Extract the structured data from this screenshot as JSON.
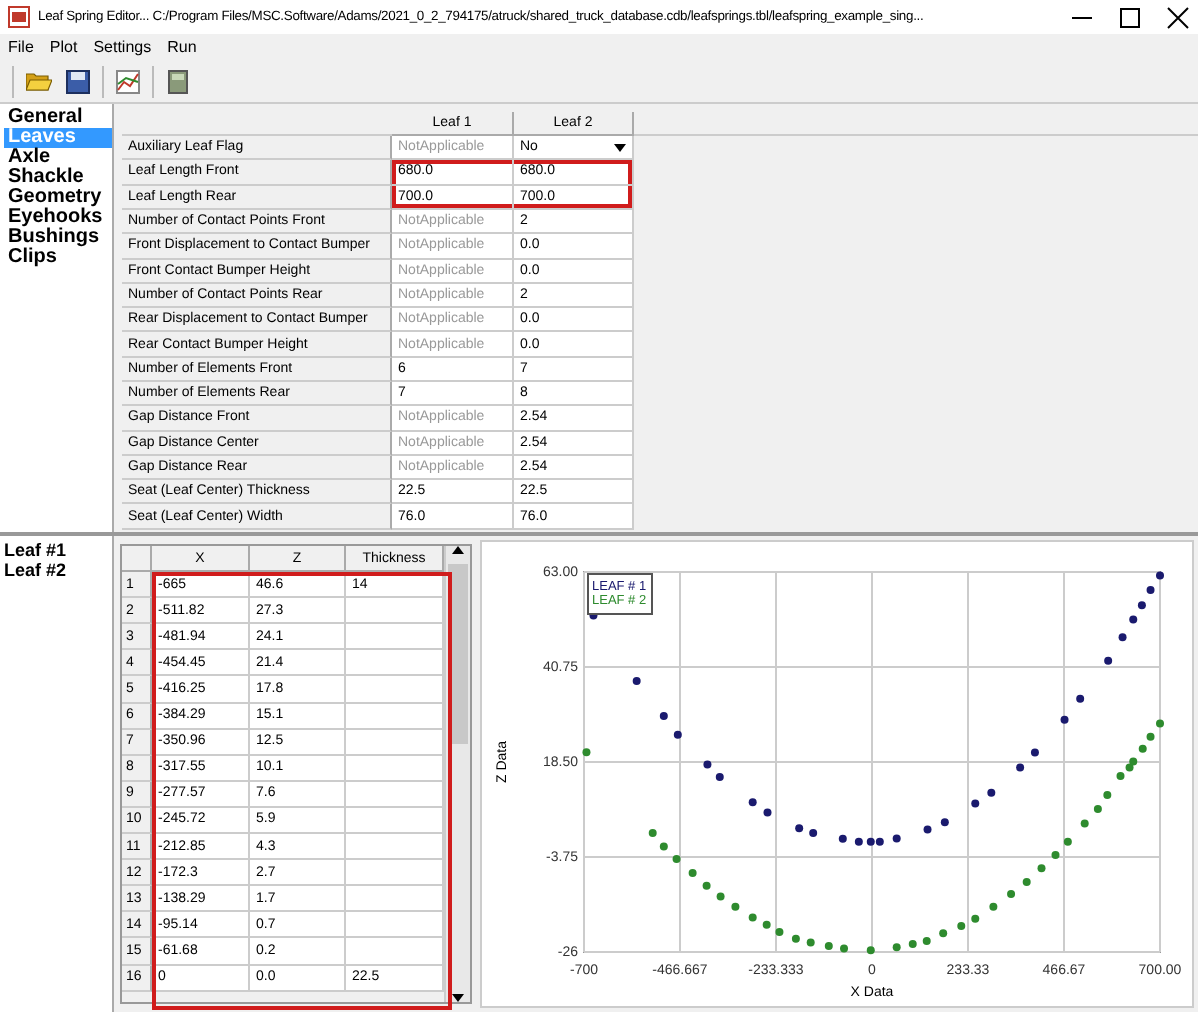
{
  "window": {
    "title": "Leaf Spring Editor... C:/Program Files/MSC.Software/Adams/2021_0_2_794175/atruck/shared_truck_database.cdb/leafsprings.tbl/leafspring_example_sing..."
  },
  "menu": [
    "File",
    "Plot",
    "Settings",
    "Run"
  ],
  "nav": [
    {
      "label": "General",
      "selected": false
    },
    {
      "label": "Leaves",
      "selected": true
    },
    {
      "label": "Axle",
      "selected": false
    },
    {
      "label": "Shackle",
      "selected": false
    },
    {
      "label": "Geometry",
      "selected": false
    },
    {
      "label": "Eyehooks",
      "selected": false
    },
    {
      "label": "Bushings",
      "selected": false
    },
    {
      "label": "Clips",
      "selected": false
    }
  ],
  "properties": {
    "columns": [
      "Leaf 1",
      "Leaf 2"
    ],
    "rows": [
      {
        "label": "Auxiliary Leaf Flag",
        "highlighted": false,
        "cells": [
          {
            "value": "NotApplicable",
            "disabled": true,
            "kind": "text"
          },
          {
            "value": "No",
            "disabled": false,
            "kind": "dropdown"
          }
        ]
      },
      {
        "label": "Leaf Length Front",
        "highlighted": true,
        "cells": [
          {
            "value": "680.0",
            "disabled": false,
            "kind": "text"
          },
          {
            "value": "680.0",
            "disabled": false,
            "kind": "text"
          }
        ]
      },
      {
        "label": "Leaf Length Rear",
        "highlighted": true,
        "cells": [
          {
            "value": "700.0",
            "disabled": false,
            "kind": "text"
          },
          {
            "value": "700.0",
            "disabled": false,
            "kind": "text"
          }
        ]
      },
      {
        "label": "Number of Contact Points Front",
        "highlighted": false,
        "cells": [
          {
            "value": "NotApplicable",
            "disabled": true,
            "kind": "text"
          },
          {
            "value": "2",
            "disabled": false,
            "kind": "text"
          }
        ]
      },
      {
        "label": "Front Displacement to Contact Bumper",
        "highlighted": false,
        "cells": [
          {
            "value": "NotApplicable",
            "disabled": true,
            "kind": "text"
          },
          {
            "value": "0.0",
            "disabled": false,
            "kind": "text"
          }
        ]
      },
      {
        "label": "Front Contact Bumper Height",
        "highlighted": false,
        "cells": [
          {
            "value": "NotApplicable",
            "disabled": true,
            "kind": "text"
          },
          {
            "value": "0.0",
            "disabled": false,
            "kind": "text"
          }
        ]
      },
      {
        "label": "Number of Contact Points Rear",
        "highlighted": false,
        "cells": [
          {
            "value": "NotApplicable",
            "disabled": true,
            "kind": "text"
          },
          {
            "value": "2",
            "disabled": false,
            "kind": "text"
          }
        ]
      },
      {
        "label": "Rear Displacement to Contact Bumper",
        "highlighted": false,
        "cells": [
          {
            "value": "NotApplicable",
            "disabled": true,
            "kind": "text"
          },
          {
            "value": "0.0",
            "disabled": false,
            "kind": "text"
          }
        ]
      },
      {
        "label": "Rear Contact Bumper Height",
        "highlighted": false,
        "cells": [
          {
            "value": "NotApplicable",
            "disabled": true,
            "kind": "text"
          },
          {
            "value": "0.0",
            "disabled": false,
            "kind": "text"
          }
        ]
      },
      {
        "label": "Number of Elements Front",
        "highlighted": false,
        "cells": [
          {
            "value": "6",
            "disabled": false,
            "kind": "text"
          },
          {
            "value": "7",
            "disabled": false,
            "kind": "text"
          }
        ]
      },
      {
        "label": "Number of Elements Rear",
        "highlighted": false,
        "cells": [
          {
            "value": "7",
            "disabled": false,
            "kind": "text"
          },
          {
            "value": "8",
            "disabled": false,
            "kind": "text"
          }
        ]
      },
      {
        "label": "Gap Distance Front",
        "highlighted": false,
        "cells": [
          {
            "value": "NotApplicable",
            "disabled": true,
            "kind": "text"
          },
          {
            "value": "2.54",
            "disabled": false,
            "kind": "text"
          }
        ]
      },
      {
        "label": "Gap Distance Center",
        "highlighted": false,
        "cells": [
          {
            "value": "NotApplicable",
            "disabled": true,
            "kind": "text"
          },
          {
            "value": "2.54",
            "disabled": false,
            "kind": "text"
          }
        ]
      },
      {
        "label": "Gap Distance Rear",
        "highlighted": false,
        "cells": [
          {
            "value": "NotApplicable",
            "disabled": true,
            "kind": "text"
          },
          {
            "value": "2.54",
            "disabled": false,
            "kind": "text"
          }
        ]
      },
      {
        "label": "Seat (Leaf Center) Thickness",
        "highlighted": false,
        "cells": [
          {
            "value": "22.5",
            "disabled": false,
            "kind": "text"
          },
          {
            "value": "22.5",
            "disabled": false,
            "kind": "text"
          }
        ]
      },
      {
        "label": "Seat (Leaf Center) Width",
        "highlighted": false,
        "cells": [
          {
            "value": "76.0",
            "disabled": false,
            "kind": "text"
          },
          {
            "value": "76.0",
            "disabled": false,
            "kind": "text"
          }
        ]
      }
    ]
  },
  "leaves": [
    {
      "label": "Leaf #1"
    },
    {
      "label": "Leaf #2"
    }
  ],
  "points": {
    "highlighted": true,
    "columns": [
      "X",
      "Z",
      "Thickness"
    ],
    "rows": [
      {
        "index": "1",
        "cells": [
          "-665",
          "46.6",
          "14"
        ]
      },
      {
        "index": "2",
        "cells": [
          "-511.82",
          "27.3",
          ""
        ]
      },
      {
        "index": "3",
        "cells": [
          "-481.94",
          "24.1",
          ""
        ]
      },
      {
        "index": "4",
        "cells": [
          "-454.45",
          "21.4",
          ""
        ]
      },
      {
        "index": "5",
        "cells": [
          "-416.25",
          "17.8",
          ""
        ]
      },
      {
        "index": "6",
        "cells": [
          "-384.29",
          "15.1",
          ""
        ]
      },
      {
        "index": "7",
        "cells": [
          "-350.96",
          "12.5",
          ""
        ]
      },
      {
        "index": "8",
        "cells": [
          "-317.55",
          "10.1",
          ""
        ]
      },
      {
        "index": "9",
        "cells": [
          "-277.57",
          "7.6",
          ""
        ]
      },
      {
        "index": "10",
        "cells": [
          "-245.72",
          "5.9",
          ""
        ]
      },
      {
        "index": "11",
        "cells": [
          "-212.85",
          "4.3",
          ""
        ]
      },
      {
        "index": "12",
        "cells": [
          "-172.3",
          "2.7",
          ""
        ]
      },
      {
        "index": "13",
        "cells": [
          "-138.29",
          "1.7",
          ""
        ]
      },
      {
        "index": "14",
        "cells": [
          "-95.14",
          "0.7",
          ""
        ]
      },
      {
        "index": "15",
        "cells": [
          "-61.68",
          "0.2",
          ""
        ]
      },
      {
        "index": "16",
        "cells": [
          "0",
          "0.0",
          "22.5"
        ]
      }
    ]
  },
  "plot": {
    "chart_data": {
      "type": "scatter",
      "grid": true,
      "xlabel": "X Data",
      "ylabel": "Z Data",
      "xlim": [
        -700,
        700
      ],
      "ylim": [
        -26,
        63
      ],
      "xticks": [
        {
          "value": -700,
          "label": "-700"
        },
        {
          "value": -466.667,
          "label": "-466.667"
        },
        {
          "value": -233.333,
          "label": "-233.333"
        },
        {
          "value": 0,
          "label": "0"
        },
        {
          "value": 233.33,
          "label": "233.33"
        },
        {
          "value": 466.67,
          "label": "466.67"
        },
        {
          "value": 700,
          "label": "700.00"
        }
      ],
      "yticks": [
        {
          "value": 63,
          "label": "63.00"
        },
        {
          "value": 40.75,
          "label": "40.75"
        },
        {
          "value": 18.5,
          "label": "18.50"
        },
        {
          "value": -3.75,
          "label": "-3.75"
        },
        {
          "value": -26,
          "label": "-26"
        }
      ],
      "series": [
        {
          "name": "LEAF # 1",
          "color": "#1a1a6e",
          "x": [
            -677,
            -572,
            -506,
            -472,
            -400,
            -370,
            -290,
            -254,
            -177,
            -143,
            -71,
            -32,
            -3,
            19,
            60,
            135,
            177,
            251,
            290,
            360,
            396,
            468,
            506,
            574,
            609,
            635,
            656,
            677,
            700
          ],
          "values": [
            52.8,
            37.5,
            29.3,
            24.9,
            17.9,
            15.0,
            9.1,
            6.7,
            3.0,
            1.9,
            0.5,
            -0.2,
            -0.2,
            -0.2,
            0.6,
            2.7,
            4.4,
            8.8,
            11.3,
            17.2,
            20.7,
            28.4,
            33.3,
            42.2,
            47.7,
            51.9,
            55.2,
            58.8,
            62.2
          ]
        },
        {
          "name": "LEAF # 2",
          "color": "#2e8b2e",
          "x": [
            -694,
            -533,
            -506,
            -475,
            -436,
            -402,
            -368,
            -332,
            -290,
            -256,
            -225,
            -185,
            -149,
            -105,
            -68,
            -3,
            60,
            99,
            133,
            173,
            217,
            251,
            295,
            338,
            376,
            412,
            446,
            476,
            517,
            549,
            572,
            604,
            626,
            635,
            658,
            677,
            700
          ],
          "values": [
            20.8,
            1.9,
            -1.3,
            -4.2,
            -7.5,
            -10.5,
            -13.0,
            -15.4,
            -17.9,
            -19.6,
            -21.3,
            -22.9,
            -23.8,
            -24.6,
            -25.2,
            -25.6,
            -24.9,
            -24.1,
            -23.4,
            -21.6,
            -19.9,
            -18.2,
            -15.4,
            -12.4,
            -9.6,
            -6.4,
            -3.3,
            -0.2,
            4.1,
            7.5,
            10.8,
            15.2,
            17.2,
            18.6,
            21.6,
            24.4,
            27.5
          ]
        }
      ]
    }
  }
}
